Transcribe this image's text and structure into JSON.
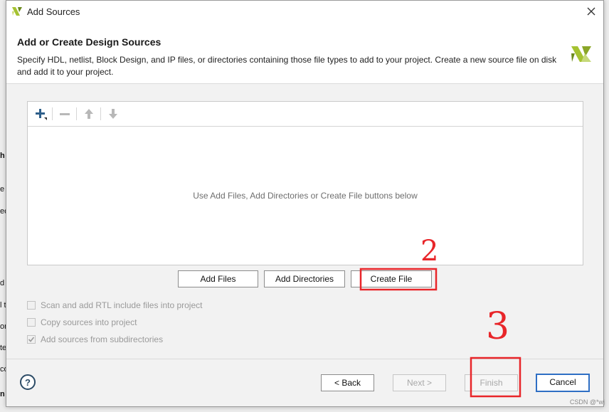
{
  "window": {
    "title": "Add Sources",
    "close_icon": "close-icon"
  },
  "header": {
    "title": "Add or Create Design Sources",
    "description": "Specify HDL, netlist, Block Design, and IP files, or directories containing those file types to add to your project. Create a new source file on disk and add it to your project."
  },
  "toolbar": {
    "icons": [
      "add-icon",
      "remove-icon",
      "move-up-icon",
      "move-down-icon"
    ]
  },
  "file_list": {
    "empty_message": "Use Add Files, Add Directories or Create File buttons below"
  },
  "actions": {
    "add_files": "Add Files",
    "add_directories": "Add Directories",
    "create_file": "Create File"
  },
  "options": [
    {
      "label": "Scan and add RTL include files into project",
      "checked": false,
      "enabled": false
    },
    {
      "label": "Copy sources into project",
      "checked": false,
      "enabled": false
    },
    {
      "label": "Add sources from subdirectories",
      "checked": true,
      "enabled": false
    }
  ],
  "footer": {
    "help": "?",
    "back": "< Back",
    "next": "Next >",
    "finish": "Finish",
    "cancel": "Cancel"
  },
  "annotations": {
    "mark_create": "2",
    "mark_finish": "3",
    "color": "#e8262a"
  },
  "background_fragments": [
    "h",
    "e",
    "ec",
    "d",
    "l t",
    "on",
    "te",
    "co",
    "n"
  ],
  "watermark": "CSDN @*wj",
  "colors": {
    "logo_green": "#a5c231",
    "logo_dark": "#6b8a1c",
    "primary_border": "#2f6fc4",
    "toolbar_add": "#3a6f9e"
  }
}
